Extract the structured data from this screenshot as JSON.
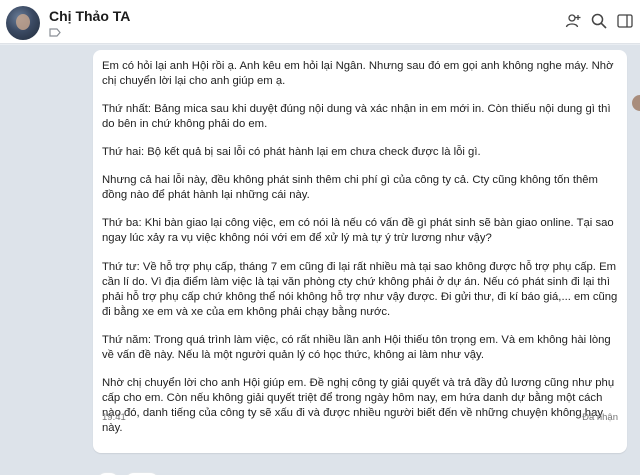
{
  "header": {
    "contact_name": "Chị Thảo TA"
  },
  "message": {
    "paragraphs": [
      "Em có hỏi lại anh Hội rồi ạ. Anh kêu em hỏi lại Ngân. Nhưng sau đó em gọi anh không nghe máy. Nhờ chị chuyển lời lại cho anh giúp em ạ.",
      "Thứ nhất: Bảng mica sau khi duyệt đúng nội dung và xác nhận in em mới in. Còn thiếu nội dung gì thì do bên in chứ không phải do em.",
      "Thứ hai: Bộ kết quả bị sai lỗi có phát hành lại em chưa check được là lỗi gì.",
      "Nhưng cả hai lỗi này, đều không phát sinh thêm chi phí gì của công ty cả. Cty cũng không tốn thêm đồng nào để phát hành lại những cái này.",
      "Thứ ba: Khi bàn giao lại công việc, em có nói là nếu có vấn đề gì phát sinh sẽ bàn giao online. Tại sao ngay lúc xảy ra vụ việc không nói với em để xử lý mà tự ý trừ lương như vậy?",
      "Thứ tư: Về hỗ trợ phụ cấp, tháng 7 em cũng đi lại rất nhiều mà tại sao không được hỗ trợ phụ cấp. Em cần lí do. Vì địa điểm làm việc là tại văn phòng cty chứ không phải ở dự án. Nếu có phát sinh đi lại thì phải hỗ trợ phụ cấp chứ không thể nói không hỗ trợ như vậy được. Đi gửi thư, đi kí báo giá,... em cũng đi bằng xe em và xe của em không phải chạy bằng nước.",
      "Thứ năm: Trong quá trình làm việc, có rất nhiều lần anh Hội thiếu tôn trọng em. Và em không hài lòng về vấn đề này. Nếu là một người quản lý có học thức, không ai làm như vậy.",
      "Nhờ chị chuyển lời cho anh Hội giúp em. Đề nghị công ty giải quyết và trả đầy đủ lương cũng như phụ cấp cho em. Còn nếu không giải quyết triệt để trong ngày hôm nay, em hứa danh dự bằng một cách nào đó, danh tiếng của công ty sẽ xấu đi và được nhiều người biết đến về những chuyện không hay này."
    ],
    "time": "19:41",
    "status": "Đã nhận"
  },
  "reactions": {
    "count": "1"
  }
}
